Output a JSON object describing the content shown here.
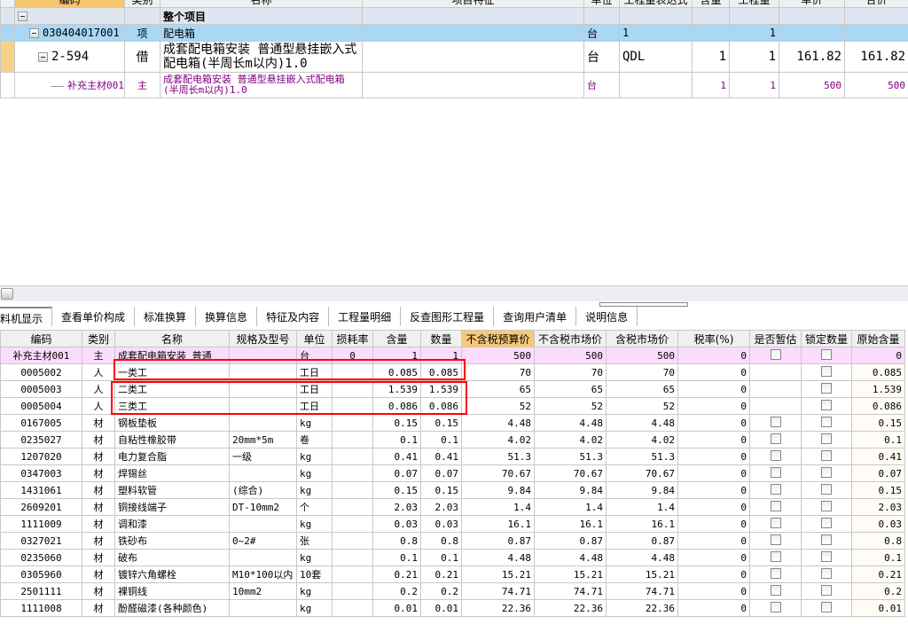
{
  "top_table": {
    "headers": [
      "编码",
      "类别",
      "名称",
      "项目特征",
      "单位",
      "工程量表达式",
      "含量",
      "工程量",
      "单价",
      "合价"
    ],
    "rows": [
      {
        "code": "",
        "type": "",
        "name": "整个项目",
        "unit": "",
        "expr": "",
        "content": "",
        "qty": "",
        "price": "",
        "total": ""
      },
      {
        "code": "030404017001",
        "type": "项",
        "name": "配电箱",
        "unit": "台",
        "expr": "1",
        "content": "",
        "qty": "1",
        "price": "",
        "total": ""
      },
      {
        "code": "2-594",
        "type": "借",
        "name": "成套配电箱安装 普通型悬挂嵌入式配电箱(半周长m以内)1.0",
        "unit": "台",
        "expr": "QDL",
        "content": "1",
        "qty": "1",
        "price": "161.82",
        "total": "161.82"
      },
      {
        "code": "补充主材001",
        "type": "主",
        "name": "成套配电箱安装 普通型悬挂嵌入式配电箱(半周长m以内)1.0",
        "unit": "台",
        "expr": "",
        "content": "1",
        "qty": "1",
        "price": "500",
        "total": "500"
      }
    ]
  },
  "tabs": [
    "料机显示",
    "查看单价构成",
    "标准换算",
    "换算信息",
    "特征及内容",
    "工程量明细",
    "反查图形工程量",
    "查询用户清单",
    "说明信息"
  ],
  "bottom_table": {
    "headers": [
      "编码",
      "类别",
      "名称",
      "规格及型号",
      "单位",
      "损耗率",
      "含量",
      "数量",
      "不含税预算价",
      "不含税市场价",
      "含税市场价",
      "税率(%)",
      "是否暂估",
      "锁定数量",
      "原始含量"
    ],
    "rows": [
      [
        "补充主材001",
        "主",
        "成套配电箱安装 普通",
        "",
        "台",
        "0",
        "1",
        "1",
        "500",
        "500",
        "500",
        "0",
        true,
        true,
        "0"
      ],
      [
        "0005002",
        "人",
        "一类工",
        "",
        "工日",
        "",
        "0.085",
        "0.085",
        "70",
        "70",
        "70",
        "0",
        null,
        true,
        "0.085"
      ],
      [
        "0005003",
        "人",
        "二类工",
        "",
        "工日",
        "",
        "1.539",
        "1.539",
        "65",
        "65",
        "65",
        "0",
        null,
        true,
        "1.539"
      ],
      [
        "0005004",
        "人",
        "三类工",
        "",
        "工日",
        "",
        "0.086",
        "0.086",
        "52",
        "52",
        "52",
        "0",
        null,
        true,
        "0.086"
      ],
      [
        "0167005",
        "材",
        "钢板垫板",
        "",
        "kg",
        "",
        "0.15",
        "0.15",
        "4.48",
        "4.48",
        "4.48",
        "0",
        true,
        true,
        "0.15"
      ],
      [
        "0235027",
        "材",
        "自粘性橡胶带",
        "20mm*5m",
        "卷",
        "",
        "0.1",
        "0.1",
        "4.02",
        "4.02",
        "4.02",
        "0",
        true,
        true,
        "0.1"
      ],
      [
        "1207020",
        "材",
        "电力复合脂",
        "一级",
        "kg",
        "",
        "0.41",
        "0.41",
        "51.3",
        "51.3",
        "51.3",
        "0",
        true,
        true,
        "0.41"
      ],
      [
        "0347003",
        "材",
        "焊锡丝",
        "",
        "kg",
        "",
        "0.07",
        "0.07",
        "70.67",
        "70.67",
        "70.67",
        "0",
        true,
        true,
        "0.07"
      ],
      [
        "1431061",
        "材",
        "塑料软管",
        "(综合)",
        "kg",
        "",
        "0.15",
        "0.15",
        "9.84",
        "9.84",
        "9.84",
        "0",
        true,
        true,
        "0.15"
      ],
      [
        "2609201",
        "材",
        "铜接线端子",
        "DT-10mm2",
        "个",
        "",
        "2.03",
        "2.03",
        "1.4",
        "1.4",
        "1.4",
        "0",
        true,
        true,
        "2.03"
      ],
      [
        "1111009",
        "材",
        "调和漆",
        "",
        "kg",
        "",
        "0.03",
        "0.03",
        "16.1",
        "16.1",
        "16.1",
        "0",
        true,
        true,
        "0.03"
      ],
      [
        "0327021",
        "材",
        "铁砂布",
        "0~2#",
        "张",
        "",
        "0.8",
        "0.8",
        "0.87",
        "0.87",
        "0.87",
        "0",
        true,
        true,
        "0.8"
      ],
      [
        "0235060",
        "材",
        "破布",
        "",
        "kg",
        "",
        "0.1",
        "0.1",
        "4.48",
        "4.48",
        "4.48",
        "0",
        true,
        true,
        "0.1"
      ],
      [
        "0305960",
        "材",
        "镀锌六角螺栓",
        "M10*100以内",
        "10套",
        "",
        "0.21",
        "0.21",
        "15.21",
        "15.21",
        "15.21",
        "0",
        true,
        true,
        "0.21"
      ],
      [
        "2501111",
        "材",
        "裸铜线",
        "10mm2",
        "kg",
        "",
        "0.2",
        "0.2",
        "74.71",
        "74.71",
        "74.71",
        "0",
        true,
        true,
        "0.2"
      ],
      [
        "1111008",
        "材",
        "酚醛磁漆(各种颜色)",
        "",
        "kg",
        "",
        "0.01",
        "0.01",
        "22.36",
        "22.36",
        "22.36",
        "0",
        true,
        true,
        "0.01"
      ]
    ]
  }
}
